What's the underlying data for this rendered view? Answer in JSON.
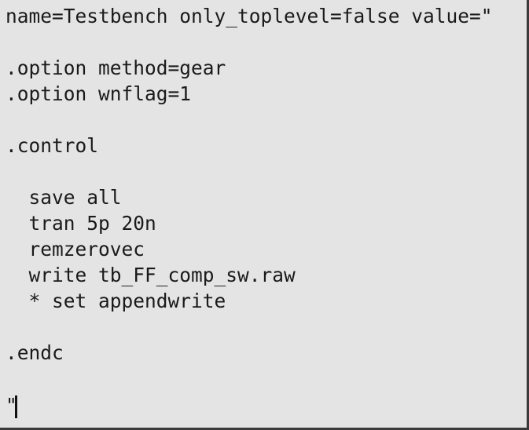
{
  "editor": {
    "lines": [
      "name=Testbench only_toplevel=false value=\"",
      "",
      ".option method=gear",
      ".option wnflag=1",
      "",
      ".control",
      "",
      "  save all",
      "  tran 5p 20n",
      "  remzerovec",
      "  write tb_FF_comp_sw.raw",
      "  * set appendwrite",
      "",
      ".endc",
      "",
      "\""
    ]
  }
}
